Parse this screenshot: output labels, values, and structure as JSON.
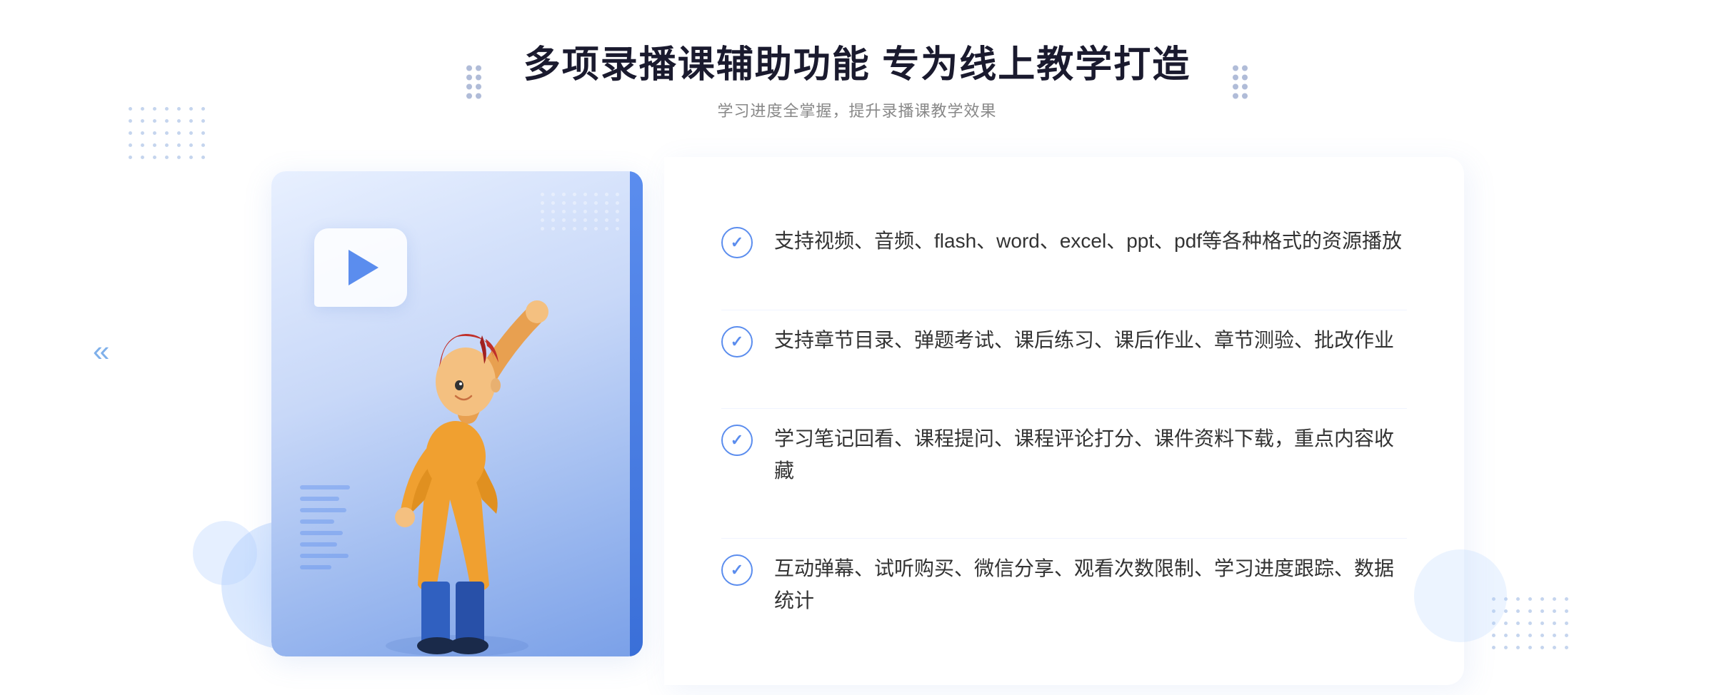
{
  "header": {
    "main_title": "多项录播课辅助功能 专为线上教学打造",
    "sub_title": "学习进度全掌握，提升录播课教学效果"
  },
  "features": [
    {
      "id": "feature-1",
      "text": "支持视频、音频、flash、word、excel、ppt、pdf等各种格式的资源播放"
    },
    {
      "id": "feature-2",
      "text": "支持章节目录、弹题考试、课后练习、课后作业、章节测验、批改作业"
    },
    {
      "id": "feature-3",
      "text": "学习笔记回看、课程提问、课程评论打分、课件资料下载，重点内容收藏"
    },
    {
      "id": "feature-4",
      "text": "互动弹幕、试听购买、微信分享、观看次数限制、学习进度跟踪、数据统计"
    }
  ],
  "decoration": {
    "chevron_symbol": "«",
    "play_label": "play-button"
  },
  "colors": {
    "accent": "#5b8dee",
    "text_primary": "#1a1a2e",
    "text_secondary": "#888888",
    "feature_text": "#333333"
  }
}
